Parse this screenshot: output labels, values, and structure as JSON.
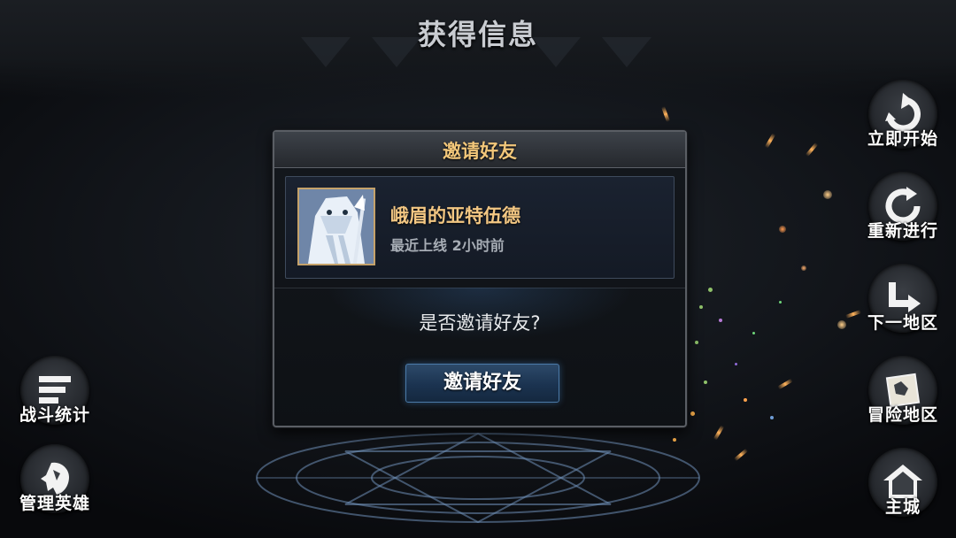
{
  "page": {
    "title": "获得信息"
  },
  "dialog": {
    "title": "邀请好友",
    "friend": {
      "name": "峨眉的亚特伍德",
      "status": "最近上线 2小时前",
      "avatar_icon": "ice-golem-portrait-icon"
    },
    "question": "是否邀请好友?",
    "invite_button": "邀请好友"
  },
  "right_menu": [
    {
      "label": "立即开始",
      "icon": "quick-start-icon"
    },
    {
      "label": "重新进行",
      "icon": "restart-icon"
    },
    {
      "label": "下一地区",
      "icon": "next-area-icon"
    },
    {
      "label": "冒险地区",
      "icon": "adventure-map-icon"
    },
    {
      "label": "主城",
      "icon": "home-icon"
    }
  ],
  "left_menu": [
    {
      "label": "战斗统计",
      "icon": "battle-stats-icon"
    },
    {
      "label": "管理英雄",
      "icon": "manage-heroes-icon"
    }
  ],
  "colors": {
    "title_gold": "#f2c77a",
    "button_blue": "#1b3350",
    "text_white": "#ffffff"
  }
}
